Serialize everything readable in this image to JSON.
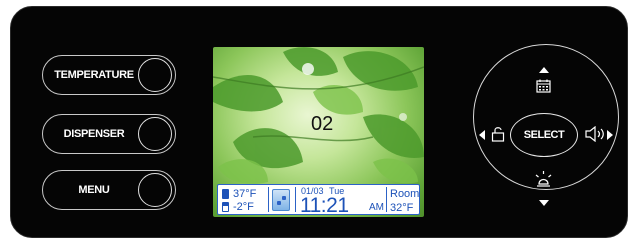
{
  "buttons": {
    "temperature": "TEMPERATURE",
    "dispenser": "DISPENSER",
    "menu": "MENU",
    "select": "SELECT"
  },
  "screen": {
    "number": "02",
    "fridge_temp": "37°F",
    "freezer_temp": "-2°F",
    "date": "01/03",
    "day": "Tue",
    "time": "11:21",
    "ampm": "AM",
    "room_label": "Room",
    "room_temp": "32°F"
  },
  "icons": {
    "up": "calendar-icon",
    "down": "light-icon",
    "left": "lock-icon",
    "right": "sound-icon"
  },
  "colors": {
    "panel": "#050505",
    "status_text": "#1d52b8",
    "status_border": "#2c62c6"
  }
}
